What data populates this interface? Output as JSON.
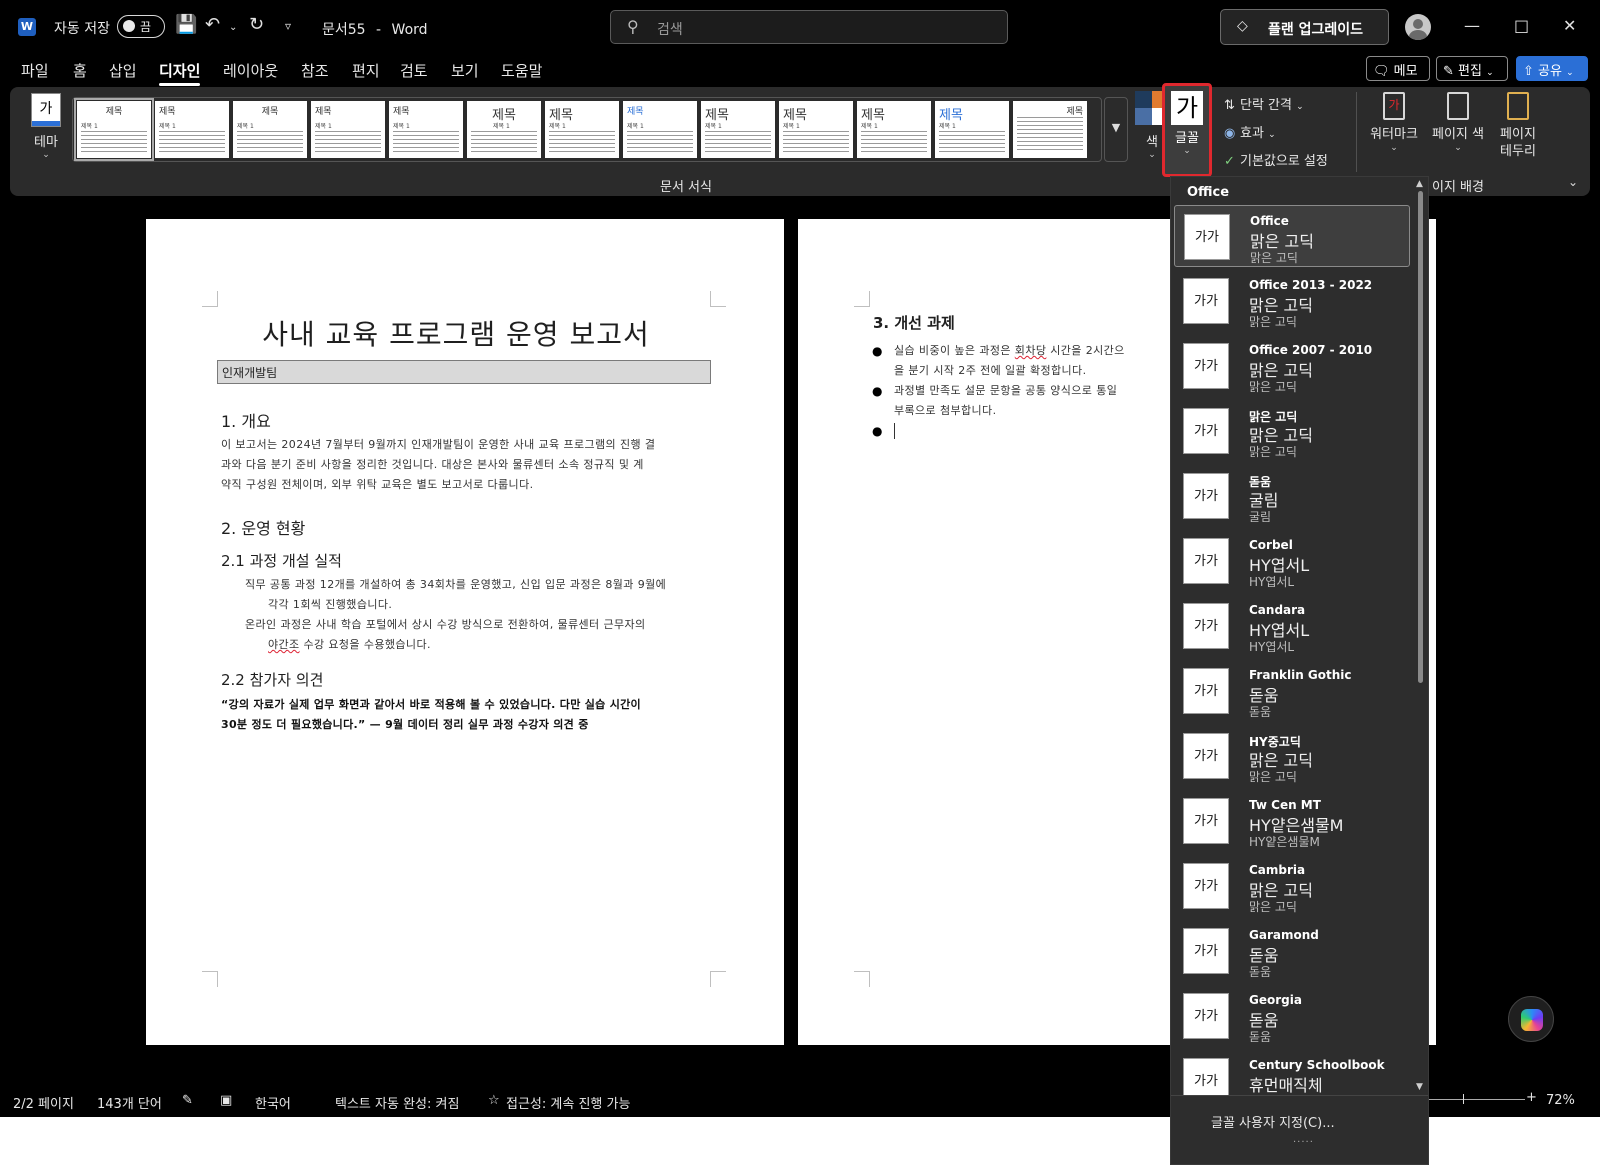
{
  "titlebar": {
    "autosave_label": "자동 저장",
    "autosave_state": "끔",
    "doc_name": "문서55",
    "separator": "-",
    "app_name": "Word",
    "search_placeholder": "검색",
    "upgrade_label": "플랜 업그레이드"
  },
  "tabs": [
    "파일",
    "홈",
    "삽입",
    "디자인",
    "레이아웃",
    "참조",
    "편지",
    "검토",
    "보기",
    "도움말"
  ],
  "active_tab": "디자인",
  "ribbon_right_buttons": {
    "memo": "메모",
    "edit": "편집",
    "share": "공유"
  },
  "ribbon": {
    "theme_label": "테마",
    "gallery": [
      {
        "title": "제목",
        "sub": "제목 1"
      },
      {
        "title": "제목",
        "sub": "제목 1"
      },
      {
        "title": "제목",
        "sub": "제목 1"
      },
      {
        "title": "제목",
        "sub": "제목 1"
      },
      {
        "title": "제목",
        "sub": "제목 1"
      },
      {
        "title": "제목",
        "sub": "제목 1"
      },
      {
        "title": "제목",
        "sub": "제목 1"
      },
      {
        "title": "제목",
        "sub": "제목 1"
      },
      {
        "title": "제목",
        "sub": "제목 1"
      },
      {
        "title": "제목",
        "sub": "제목 1"
      },
      {
        "title": "제목",
        "sub": "제목 1"
      },
      {
        "title": "제목",
        "sub": "제목 1"
      },
      {
        "title": "제목",
        "sub": ""
      }
    ],
    "colors_label": "색",
    "fonts_label": "글꼴",
    "fonts_glyph": "가",
    "paragraph_spacing": "단락 간격",
    "effects": "효과",
    "set_default": "기본값으로 설정",
    "watermark": "워터마크",
    "page_color": "페이지 색",
    "page_borders_line1": "페이지",
    "page_borders_line2": "테두리",
    "group_format": "문서 서식",
    "group_background": "이지 배경",
    "swatch_colors": [
      "#1f3b5c",
      "#e07b30",
      "#4a6fa5",
      "#ffffff"
    ]
  },
  "document": {
    "title": "사내 교육 프로그램 운영 보고서",
    "subtitle": "인재개발팀",
    "h1_overview": "1. 개요",
    "overview_l1": "이 보고서는 2024년 7월부터 9월까지 인재개발팀이 운영한 사내 교육 프로그램의 진행 결",
    "overview_l2": "과와 다음 분기 준비 사항을 정리한 것입니다. 대상은 본사와 물류센터 소속 정규직 및 계",
    "overview_l3": "약직 구성원 전체이며, 외부 위탁 교육은 별도 보고서로 다룹니다.",
    "h1_status": "2. 운영 현황",
    "h2_courses": "2.1 과정 개설 실적",
    "courses_l1": "직무 공통 과정 12개를 개설하여 총 34회차를 운영했고, 신입 입문 과정은 8월과 9월에",
    "courses_l2": "각각 1회씩 진행했습니다.",
    "courses_l3": "온라인 과정은 사내 학습 포털에서 상시 수강 방식으로 전환하여, 물류센터 근무자의",
    "courses_l4a": "야간조",
    "courses_l4b": " 수강 요청을 수용했습니다.",
    "h2_feedback": "2.2 참가자 의견",
    "quote_l1": "“강의 자료가 실제 업무 화면과 같아서 바로 적용해 볼 수 있었습니다. 다만 실습 시간이",
    "quote_l2": "30분 정도 더 필요했습니다.” — 9월 데이터 정리 실무 과정 수강자 의견 중",
    "h1_improve": "3. 개선 과제",
    "b1_l1a": "실습 비중이 높은 과정은 ",
    "b1_l1b": "회차당",
    "b1_l1c": " 시간을 2시간으",
    "b1_l2": "을 분기 시작 2주 전에 일괄 확정합니다.",
    "b2_l1": "과정별 만족도 설문 문항을 공통 양식으로 통일",
    "b2_l2": "부록으로 첨부합니다."
  },
  "font_dropdown": {
    "header": "Office",
    "items": [
      {
        "name": "Office",
        "heading": "맑은 고딕",
        "body": "맑은 고딕",
        "preview": "가가",
        "selected": true
      },
      {
        "name": "Office 2013 - 2022",
        "heading": "맑은 고딕",
        "body": "맑은 고딕",
        "preview": "가가"
      },
      {
        "name": "Office 2007 - 2010",
        "heading": "맑은 고딕",
        "body": "맑은 고딕",
        "preview": "가가"
      },
      {
        "name": "맑은 고딕",
        "heading": "맑은 고딕",
        "body": "맑은 고딕",
        "preview": "가가"
      },
      {
        "name": "돋움",
        "heading": "굴림",
        "body": "굴림",
        "preview": "가가"
      },
      {
        "name": "Corbel",
        "heading": "HY엽서L",
        "body": "HY엽서L",
        "preview": "가가"
      },
      {
        "name": "Candara",
        "heading": "HY엽서L",
        "body": "HY엽서L",
        "preview": "가가"
      },
      {
        "name": "Franklin Gothic",
        "heading": "돋움",
        "body": "돋움",
        "preview": "가가"
      },
      {
        "name": "HY중고딕",
        "heading": "맑은 고딕",
        "body": "맑은 고딕",
        "preview": "가가"
      },
      {
        "name": "Tw Cen MT",
        "heading": "HY얕은샘물M",
        "body": "HY얕은샘물M",
        "preview": "가가"
      },
      {
        "name": "Cambria",
        "heading": "맑은 고딕",
        "body": "맑은 고딕",
        "preview": "가가"
      },
      {
        "name": "Garamond",
        "heading": "돋움",
        "body": "돋움",
        "preview": "가가"
      },
      {
        "name": "Georgia",
        "heading": "돋움",
        "body": "돋움",
        "preview": "가가"
      },
      {
        "name": "Century Schoolbook",
        "heading": "휴먼매직체",
        "body": "휴먼매직체",
        "preview": "가가"
      }
    ],
    "footer": "글꼴 사용자 지정(C)...",
    "grip": "....."
  },
  "statusbar": {
    "pages": "2/2 페이지",
    "words": "143개 단어",
    "language": "한국어",
    "autocomplete": "텍스트 자동 완성: 켜짐",
    "accessibility": "접근성: 계속 진행 가능",
    "zoom_minus": "-",
    "zoom_plus": "+",
    "zoom": "72%"
  }
}
